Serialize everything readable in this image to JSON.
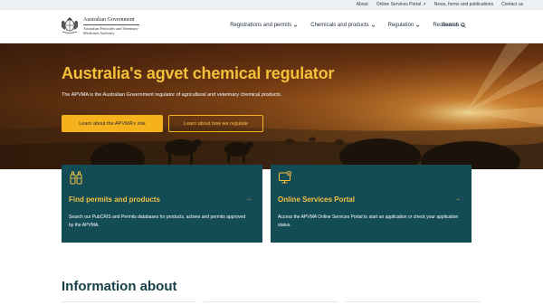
{
  "utility_nav": {
    "links": [
      {
        "label": "About"
      },
      {
        "label": "Online Services Portal ↗"
      },
      {
        "label": "News, forms and publications"
      },
      {
        "label": "Contact us"
      }
    ]
  },
  "header": {
    "logo": {
      "government": "Australian Government",
      "agency": "Australian Pesticides and Veterinary Medicines Authority"
    },
    "nav": [
      {
        "label": "Registrations and permits"
      },
      {
        "label": "Chemicals and products"
      },
      {
        "label": "Regulation"
      },
      {
        "label": "Resources"
      }
    ],
    "search_label": "Search"
  },
  "hero": {
    "title": "Australia's agvet chemical regulator",
    "subtitle": "The APVMA is the Australian Government regulator of agricultural and veterinary chemical products.",
    "primary_button": "Learn about the APVMA's role",
    "secondary_button": "Learn about how we regulate"
  },
  "cards": [
    {
      "title": "Find permits and products",
      "description": "Search our PubCRIS and Permits databases for products, actives and permits approved by the APVMA.",
      "icon": "search-database-icon",
      "arrow": "→"
    },
    {
      "title": "Online Services Portal",
      "description": "Access the APVMA Online Services Portal to start an application or check your application status.",
      "icon": "monitor-icon",
      "arrow": "→"
    }
  ],
  "section": {
    "title": "Information about"
  },
  "colors": {
    "accent": "#f5b21d",
    "card_bg": "#144c55",
    "heading": "#17404a"
  }
}
